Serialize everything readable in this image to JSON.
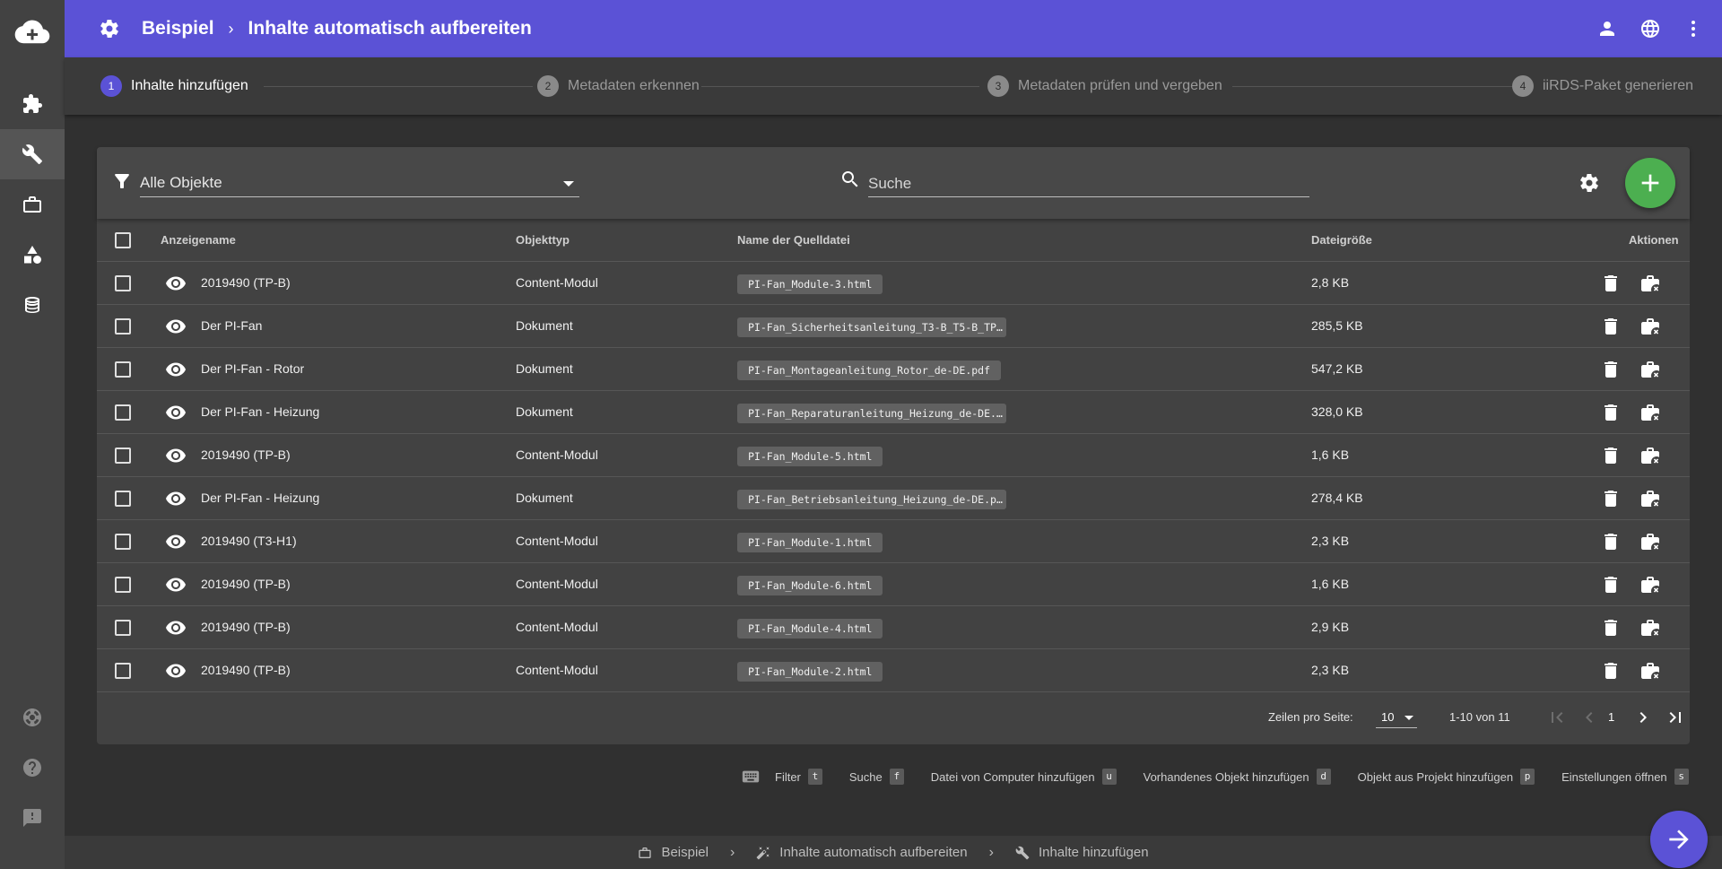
{
  "topbar": {
    "project": "Beispiel",
    "separator": "›",
    "page_title": "Inhalte automatisch aufbereiten"
  },
  "stepper": [
    {
      "num": "1",
      "label": "Inhalte hinzufügen",
      "active": true
    },
    {
      "num": "2",
      "label": "Metadaten erkennen",
      "active": false
    },
    {
      "num": "3",
      "label": "Metadaten prüfen und vergeben",
      "active": false
    },
    {
      "num": "4",
      "label": "iiRDS-Paket generieren",
      "active": false
    }
  ],
  "toolbar": {
    "filter_value": "Alle Objekte",
    "search_placeholder": "Suche"
  },
  "table": {
    "headers": {
      "name": "Anzeigename",
      "type": "Objekttyp",
      "source": "Name der Quelldatei",
      "size": "Dateigröße",
      "actions": "Aktionen"
    },
    "rows": [
      {
        "name": "2019490 (TP-B)",
        "type": "Content-Modul",
        "source": "PI-Fan_Module-3.html",
        "size": "2,8 KB"
      },
      {
        "name": "Der PI-Fan",
        "type": "Dokument",
        "source": "PI-Fan_Sicherheitsanleitung_T3-B_T5-B_TP…",
        "size": "285,5 KB"
      },
      {
        "name": "Der PI-Fan - Rotor",
        "type": "Dokument",
        "source": "PI-Fan_Montageanleitung_Rotor_de-DE.pdf",
        "size": "547,2 KB"
      },
      {
        "name": "Der PI-Fan - Heizung",
        "type": "Dokument",
        "source": "PI-Fan_Reparaturanleitung_Heizung_de-DE.…",
        "size": "328,0 KB"
      },
      {
        "name": "2019490 (TP-B)",
        "type": "Content-Modul",
        "source": "PI-Fan_Module-5.html",
        "size": "1,6 KB"
      },
      {
        "name": "Der PI-Fan - Heizung",
        "type": "Dokument",
        "source": "PI-Fan_Betriebsanleitung_Heizung_de-DE.p…",
        "size": "278,4 KB"
      },
      {
        "name": "2019490 (T3-H1)",
        "type": "Content-Modul",
        "source": "PI-Fan_Module-1.html",
        "size": "2,3 KB"
      },
      {
        "name": "2019490 (TP-B)",
        "type": "Content-Modul",
        "source": "PI-Fan_Module-6.html",
        "size": "1,6 KB"
      },
      {
        "name": "2019490 (TP-B)",
        "type": "Content-Modul",
        "source": "PI-Fan_Module-4.html",
        "size": "2,9 KB"
      },
      {
        "name": "2019490 (TP-B)",
        "type": "Content-Modul",
        "source": "PI-Fan_Module-2.html",
        "size": "2,3 KB"
      }
    ]
  },
  "pagination": {
    "rows_per_page_label": "Zeilen pro Seite:",
    "rows_per_page": "10",
    "range": "1-10 von 11",
    "page": "1"
  },
  "shortcuts": [
    {
      "label": "Filter",
      "key": "t"
    },
    {
      "label": "Suche",
      "key": "f"
    },
    {
      "label": "Datei von Computer hinzufügen",
      "key": "u"
    },
    {
      "label": "Vorhandenes Objekt hinzufügen",
      "key": "d"
    },
    {
      "label": "Objekt aus Projekt hinzufügen",
      "key": "p"
    },
    {
      "label": "Einstellungen öffnen",
      "key": "s"
    }
  ],
  "bottom_breadcrumb": {
    "project": "Beispiel",
    "workflow": "Inhalte automatisch aufbereiten",
    "step": "Inhalte hinzufügen"
  },
  "colors": {
    "accent": "#5b52d6",
    "add_button": "#4caf50",
    "background": "#303030",
    "panel": "#424242"
  }
}
